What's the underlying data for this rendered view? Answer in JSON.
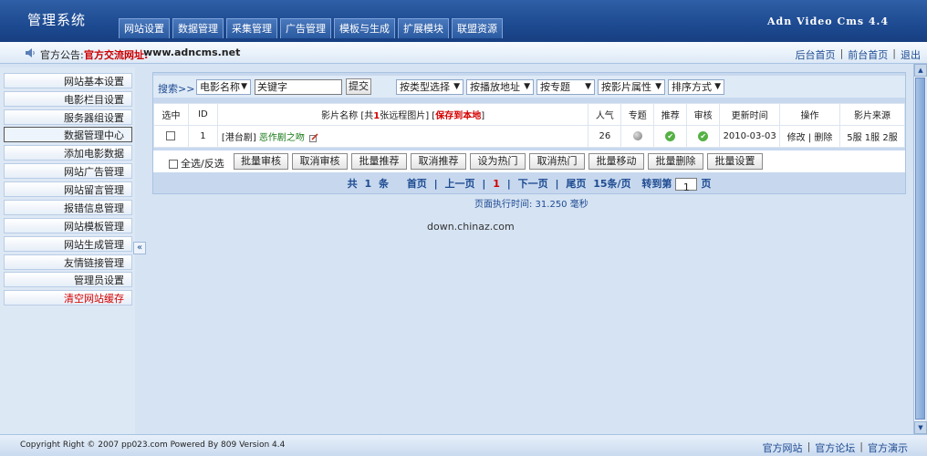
{
  "header": {
    "title": "管理系统",
    "version": "Adn Video Cms 4.4",
    "tabs": [
      "网站设置",
      "数据管理",
      "采集管理",
      "广告管理",
      "模板与生成",
      "扩展模块",
      "联盟资源"
    ]
  },
  "notice": {
    "label": "官方公告:",
    "link_label": "官方交流网址:",
    "url": "www.adncms.net"
  },
  "top_links": [
    "后台首页",
    "前台首页",
    "退出"
  ],
  "sidebar": {
    "items": [
      "网站基本设置",
      "电影栏目设置",
      "服务器组设置",
      "数据管理中心",
      "添加电影数据",
      "网站广告管理",
      "网站留言管理",
      "报错信息管理",
      "网站模板管理",
      "网站生成管理",
      "友情链接管理",
      "管理员设置",
      "清空网站缓存"
    ],
    "collapse_label": "«"
  },
  "filter": {
    "label": "搜索>>",
    "field_select": "电影名称",
    "keyword_value": "关键字",
    "submit_label": "提交",
    "selects": [
      "按类型选择",
      "按播放地址",
      "按专题",
      "按影片属性",
      "排序方式"
    ]
  },
  "table": {
    "headers": {
      "select": "选中",
      "id": "ID",
      "name_prefix": "影片名称 [共",
      "name_count": "1",
      "name_mid": "张远程图片] [",
      "name_save": "保存到本地",
      "name_suffix": "]",
      "views": "人气",
      "topic": "专题",
      "recommend": "推荐",
      "audit": "审核",
      "updated": "更新时间",
      "actions": "操作",
      "source": "影片来源"
    },
    "rows": [
      {
        "id": "1",
        "category": "[港台剧]",
        "name": "恶作剧之吻",
        "views": "26",
        "updated": "2010-03-03",
        "edit": "修改",
        "delete": "删除",
        "source": "5服 1服 2服"
      }
    ]
  },
  "actions": {
    "select_all": "全选/反选",
    "buttons": [
      "批量审核",
      "取消审核",
      "批量推荐",
      "取消推荐",
      "设为热门",
      "取消热门",
      "批量移动",
      "批量删除",
      "批量设置"
    ]
  },
  "pager": {
    "total_prefix": "共",
    "total": "1",
    "total_suffix": "条",
    "first": "首页",
    "prev": "上一页",
    "current": "1",
    "next": "下一页",
    "last": "尾页",
    "per_page": "15条/页",
    "goto_prefix": "转到第",
    "goto_value": "1",
    "goto_suffix": "页"
  },
  "exec_time": "页面执行时间: 31.250 毫秒",
  "watermark": "down.chinaz.com",
  "footer": {
    "copyright": "Copyright Right © 2007 pp023.com Powered By 809 Version 4.4",
    "links": [
      "官方网站",
      "官方论坛",
      "官方演示"
    ]
  }
}
